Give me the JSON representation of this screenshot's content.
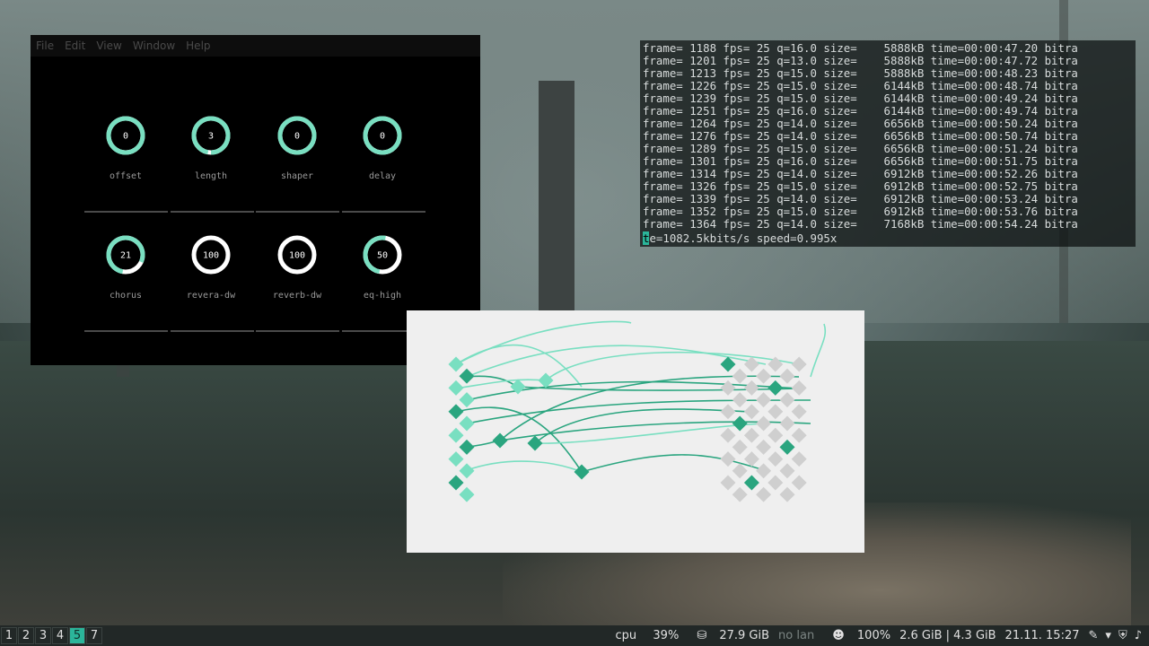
{
  "colors": {
    "accent": "#79dfc1",
    "accent_dark": "#2aa57f",
    "terminal_cursor": "#2bb59a"
  },
  "knob_window": {
    "menu": [
      "File",
      "Edit",
      "View",
      "Window",
      "Help"
    ],
    "knobs": [
      {
        "value": "0",
        "label": "offset",
        "fill": 1.0
      },
      {
        "value": "3",
        "label": "length",
        "fill": 0.97
      },
      {
        "value": "0",
        "label": "shaper",
        "fill": 1.0
      },
      {
        "value": "0",
        "label": "delay",
        "fill": 1.0
      },
      {
        "value": "21",
        "label": "chorus",
        "fill": 0.79
      },
      {
        "value": "100",
        "label": "revera-dw",
        "fill": 0.0
      },
      {
        "value": "100",
        "label": "reverb-dw",
        "fill": 0.0
      },
      {
        "value": "50",
        "label": "eq-high",
        "fill": 0.5
      }
    ]
  },
  "terminal": {
    "lines": [
      "frame= 1188 fps= 25 q=16.0 size=    5888kB time=00:00:47.20 bitra",
      "frame= 1201 fps= 25 q=13.0 size=    5888kB time=00:00:47.72 bitra",
      "frame= 1213 fps= 25 q=15.0 size=    5888kB time=00:00:48.23 bitra",
      "frame= 1226 fps= 25 q=15.0 size=    6144kB time=00:00:48.74 bitra",
      "frame= 1239 fps= 25 q=15.0 size=    6144kB time=00:00:49.24 bitra",
      "frame= 1251 fps= 25 q=16.0 size=    6144kB time=00:00:49.74 bitra",
      "frame= 1264 fps= 25 q=14.0 size=    6656kB time=00:00:50.24 bitra",
      "frame= 1276 fps= 25 q=14.0 size=    6656kB time=00:00:50.74 bitra",
      "frame= 1289 fps= 25 q=15.0 size=    6656kB time=00:00:51.24 bitra",
      "frame= 1301 fps= 25 q=16.0 size=    6656kB time=00:00:51.75 bitra",
      "frame= 1314 fps= 25 q=14.0 size=    6912kB time=00:00:52.26 bitra",
      "frame= 1326 fps= 25 q=15.0 size=    6912kB time=00:00:52.75 bitra",
      "frame= 1339 fps= 25 q=14.0 size=    6912kB time=00:00:53.24 bitra",
      "frame= 1352 fps= 25 q=15.0 size=    6912kB time=00:00:53.76 bitra",
      "frame= 1364 fps= 25 q=14.0 size=    7168kB time=00:00:54.24 bitra"
    ],
    "last_line_cursor": "t",
    "last_line_rest": "e=1082.5kbits/s speed=0.995x"
  },
  "taskbar": {
    "workspaces": [
      "1",
      "2",
      "3",
      "4",
      "5",
      "7"
    ],
    "active_workspace": "5",
    "cpu_label": "cpu",
    "cpu_value": "39%",
    "disk": "27.9 GiB",
    "network": "no lan",
    "battery": "100%",
    "memory": "2.6 GiB | 4.3 GiB",
    "datetime": "21.11. 15:27"
  }
}
